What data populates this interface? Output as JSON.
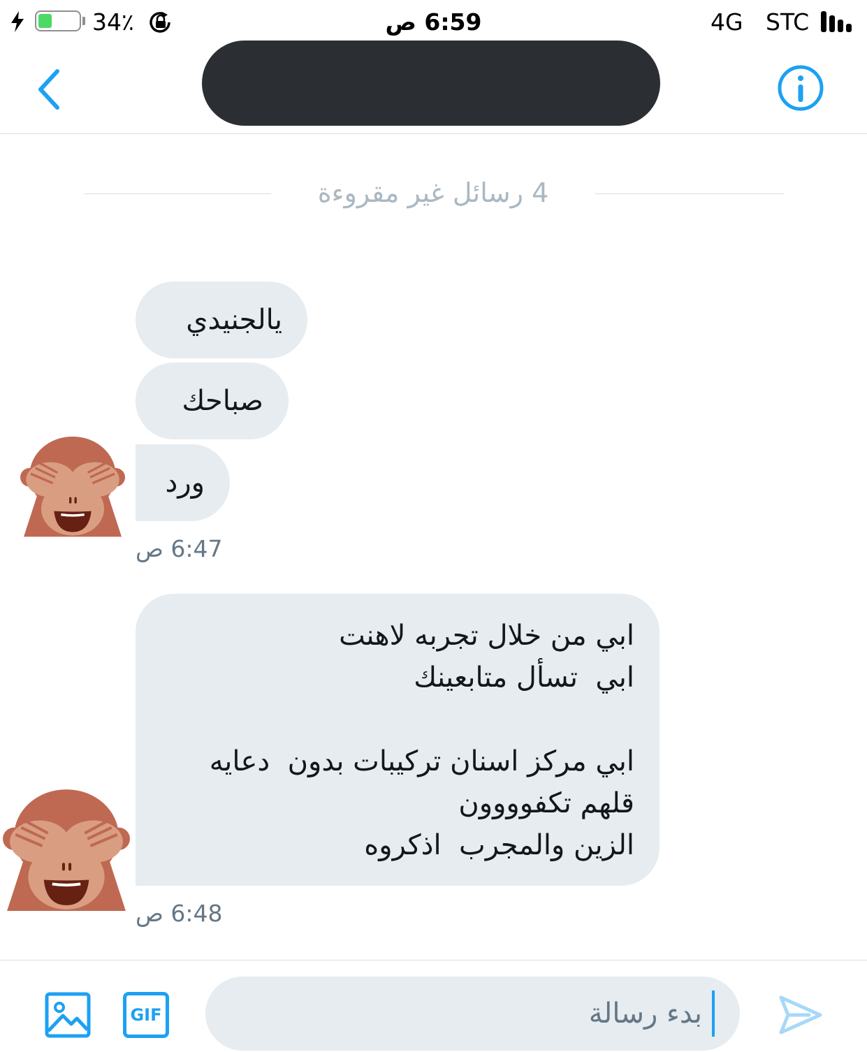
{
  "status_bar": {
    "battery_percent": "34٪",
    "battery_level": 0.34,
    "time": "6:59 ص",
    "network": "4G",
    "carrier": "STC"
  },
  "header": {
    "back_icon": "chevron-left-icon",
    "info_icon": "info-icon",
    "accent_color": "#1da1f2"
  },
  "conversation": {
    "unread_divider": "4 رسائل غير مقروءة",
    "groups": [
      {
        "messages": [
          "يالجنيدي",
          "صباحك",
          "ورد"
        ],
        "timestamp": "6:47 ص",
        "avatar": "see-no-evil-monkey-icon"
      },
      {
        "messages": [
          "ابي من خلال تجربه لاهنت\nابي  تسأل متابعينك\n\nابي مركز اسنان تركيبات بدون  دعايه\nقلهم تكفوووون\nالزين والمجرب  اذكروه"
        ],
        "timestamp": "6:48 ص",
        "avatar": "see-no-evil-monkey-icon"
      }
    ]
  },
  "composer": {
    "placeholder": "بدء رسالة",
    "image_icon": "image-icon",
    "gif_label": "GIF",
    "send_icon": "send-icon"
  }
}
